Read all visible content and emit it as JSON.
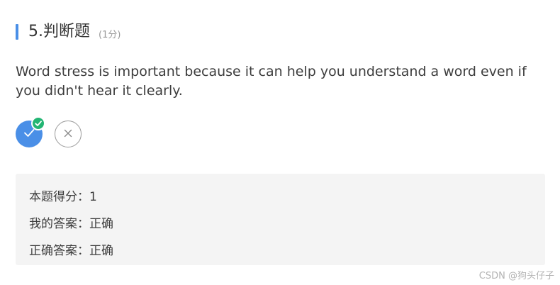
{
  "header": {
    "title": "5.判断题",
    "score": "(1分)"
  },
  "question": {
    "text": "Word stress is important because it can help you understand a word even if you didn't hear it clearly."
  },
  "options": [
    {
      "value": "true",
      "icon": "check-icon",
      "selected": true
    },
    {
      "value": "false",
      "icon": "close-icon",
      "selected": false
    }
  ],
  "colors": {
    "accent": "#4a8fe7",
    "correct_badge": "#22b573",
    "panel_bg": "#f4f4f4"
  },
  "result": {
    "score_line": "本题得分：1",
    "my_answer_line": "我的答案：正确",
    "correct_answer_line": "正确答案：正确"
  },
  "watermark": "CSDN @狗头仔子"
}
